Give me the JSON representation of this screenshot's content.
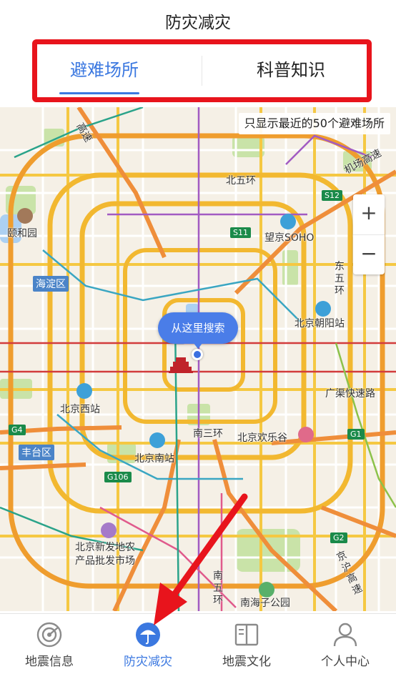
{
  "header": {
    "title": "防灾减灾"
  },
  "tabs": [
    {
      "label": "避难场所",
      "active": true
    },
    {
      "label": "科普知识",
      "active": false
    }
  ],
  "map": {
    "notice": "只显示最近的50个避难场所",
    "zoom_in": "+",
    "zoom_out": "−",
    "search_button": "从这里搜索",
    "labels": {
      "yiheyuan": "颐和园",
      "haidian": "海淀区",
      "wangjing": "望京SOHO",
      "chaoyang_station": "北京朝阳站",
      "beiwuhuan": "北五环",
      "jichang": "机场高速",
      "dongwuhuan": "东五环",
      "beijing_west": "北京西站",
      "fengtai": "丰台区",
      "beijing_south": "北京南站",
      "nansanhuan": "南三环",
      "happy_valley": "北京欢乐谷",
      "guangqu": "广渠快速路",
      "xinfadi_1": "北京新发地农",
      "xinfadi_2": "产品批发市场",
      "nanhaizi": "南海子公园",
      "jinghu": "京沪高速",
      "nanwuhuan": "南五环",
      "gaosu": "高速"
    },
    "road_badges": {
      "s11": "S11",
      "s12": "S12",
      "g4": "G4",
      "g1": "G1",
      "g106": "G106",
      "g2": "G2"
    }
  },
  "bottom_nav": [
    {
      "label": "地震信息",
      "icon": "radar-icon"
    },
    {
      "label": "防灾减灾",
      "icon": "umbrella-icon",
      "active": true
    },
    {
      "label": "地震文化",
      "icon": "book-icon"
    },
    {
      "label": "个人中心",
      "icon": "person-icon"
    }
  ],
  "colors": {
    "accent": "#3b78e0",
    "annotation": "#e8141c",
    "map_bg": "#f5f0e6",
    "ring_road": "#f2b830",
    "expressway": "#ef8e3a",
    "park": "#c5e0a5",
    "water": "#a9cdf0"
  }
}
